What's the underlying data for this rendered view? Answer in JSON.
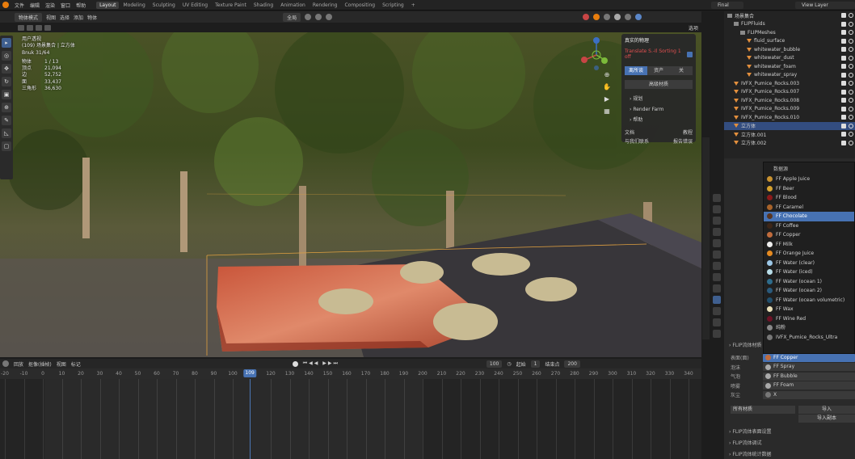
{
  "topbar": {
    "menus": [
      "文件",
      "编辑",
      "渲染",
      "窗口",
      "帮助"
    ],
    "workspaces": [
      "Layout",
      "Modeling",
      "Sculpting",
      "UV Editing",
      "Texture Paint",
      "Shading",
      "Animation",
      "Rendering",
      "Compositing",
      "Scripting"
    ],
    "active_ws": "Layout",
    "plus": "+",
    "scene": "Final",
    "layer": "View Layer"
  },
  "viewport_header": {
    "mode": "物体模式",
    "menus": [
      "视图",
      "选择",
      "添加",
      "物体"
    ],
    "transform": "全局",
    "options": "选项"
  },
  "stats": {
    "title": "用户透视",
    "subtitle": "(109) 场景集合 | 立方体",
    "hidden": "Bnuk 31/64",
    "rows": [
      {
        "k": "物体",
        "v": "1 / 13"
      },
      {
        "k": "顶点",
        "v": "21,094"
      },
      {
        "k": "边",
        "v": "52,752"
      },
      {
        "k": "面",
        "v": "33,437"
      },
      {
        "k": "三角形",
        "v": "36,630"
      }
    ]
  },
  "fp_panel": {
    "title": "真实的物理",
    "warning": "Translate S.-Il Sorting 1 off",
    "tabs": [
      "离所谈",
      "资产",
      "关"
    ],
    "button": "高级材质",
    "sections": [
      "规划",
      "Render Farm",
      "帮助"
    ],
    "footer_left": "文档",
    "footer_right": "教程",
    "footer_left2": "与我们联系",
    "footer_right2": "报告错误"
  },
  "outliner": {
    "rows": [
      {
        "label": "场景集合",
        "type": "coll",
        "indent": 0
      },
      {
        "label": "FLIPFluids",
        "type": "coll",
        "indent": 1
      },
      {
        "label": "FLIPMeshes",
        "type": "coll",
        "indent": 2
      },
      {
        "label": "fluid_surface",
        "type": "obj",
        "indent": 3
      },
      {
        "label": "whitewater_bubble",
        "type": "obj",
        "indent": 3
      },
      {
        "label": "whitewater_dust",
        "type": "obj",
        "indent": 3
      },
      {
        "label": "whitewater_foam",
        "type": "obj",
        "indent": 3
      },
      {
        "label": "whitewater_spray",
        "type": "obj",
        "indent": 3
      },
      {
        "label": "IVFX_Pumice_Rocks.003",
        "type": "obj",
        "indent": 1
      },
      {
        "label": "IVFX_Pumice_Rocks.007",
        "type": "obj",
        "indent": 1
      },
      {
        "label": "IVFX_Pumice_Rocks.008",
        "type": "obj",
        "indent": 1
      },
      {
        "label": "IVFX_Pumice_Rocks.009",
        "type": "obj",
        "indent": 1
      },
      {
        "label": "IVFX_Pumice_Rocks.010",
        "type": "obj",
        "indent": 1
      },
      {
        "label": "立方体",
        "type": "obj",
        "indent": 1,
        "sel": true
      },
      {
        "label": "立方体.001",
        "type": "obj",
        "indent": 1
      },
      {
        "label": "立方体.002",
        "type": "obj",
        "indent": 1
      }
    ]
  },
  "mat_dropdown": {
    "header": "数据源",
    "items": [
      {
        "label": "FF Apple Juice",
        "color": "#c99230"
      },
      {
        "label": "FF Beer",
        "color": "#d6a12d"
      },
      {
        "label": "FF Blood",
        "color": "#8c1a1a"
      },
      {
        "label": "FF Caramel",
        "color": "#a8632a"
      },
      {
        "label": "FF Chocolate",
        "color": "#5a3520",
        "hl": true
      },
      {
        "label": "FF Coffee",
        "color": "#3d2618"
      },
      {
        "label": "FF Copper",
        "color": "#c06b3c"
      },
      {
        "label": "FF Milk",
        "color": "#eeeeee"
      },
      {
        "label": "FF Orange Juice",
        "color": "#e58a20"
      },
      {
        "label": "FF Water (clear)",
        "color": "#9cc7e6"
      },
      {
        "label": "FF Water (iced)",
        "color": "#b8dde8"
      },
      {
        "label": "FF Water (ocean 1)",
        "color": "#2e6c8c"
      },
      {
        "label": "FF Water (ocean 2)",
        "color": "#2a5a7c"
      },
      {
        "label": "FF Water (ocean volumetric)",
        "color": "#22506e"
      },
      {
        "label": "FF Wax",
        "color": "#e9dfb8"
      },
      {
        "label": "FF Wine Red",
        "color": "#6e1226"
      },
      {
        "label": "纯粉",
        "color": "#888888"
      },
      {
        "label": "IVFX_Pumice_Rocks_Ultra",
        "color": "#777777"
      }
    ]
  },
  "mat_fields": [
    {
      "label": "表面(面)",
      "value": "FF Copper",
      "hl": true,
      "color": "#c06b3c"
    },
    {
      "label": "泡沫",
      "value": "FF Spray",
      "color": "#aaaaaa"
    },
    {
      "label": "气泡",
      "value": "FF Bubble",
      "color": "#aaaaaa"
    },
    {
      "label": "喷雾",
      "value": "FF Foam",
      "color": "#aaaaaa"
    },
    {
      "label": "灰尘",
      "value": "X",
      "color": "#777777"
    }
  ],
  "props": {
    "all_materials": "所有材质",
    "import_btn": "导入",
    "import_all": "导入副本",
    "sections": [
      "FLIP流体表面设置",
      "FLIP流体调试",
      "FLIP流体统计数据"
    ],
    "section_top": "FLIP流体材质"
  },
  "timeline": {
    "menus": [
      "回放",
      "抠像(插帧)",
      "视图",
      "标记"
    ],
    "current_frame": "109",
    "start_label": "起始",
    "start": "1",
    "end_label": "结束点",
    "end": "200",
    "field_100": "100",
    "ticks": [
      "-20",
      "-10",
      "0",
      "10",
      "20",
      "30",
      "40",
      "50",
      "60",
      "70",
      "80",
      "90",
      "100",
      "109",
      "120",
      "130",
      "140",
      "150",
      "160",
      "170",
      "180",
      "190",
      "200",
      "210",
      "220",
      "230",
      "240",
      "250",
      "260",
      "270",
      "280",
      "290",
      "300",
      "310",
      "320",
      "330",
      "340"
    ]
  }
}
